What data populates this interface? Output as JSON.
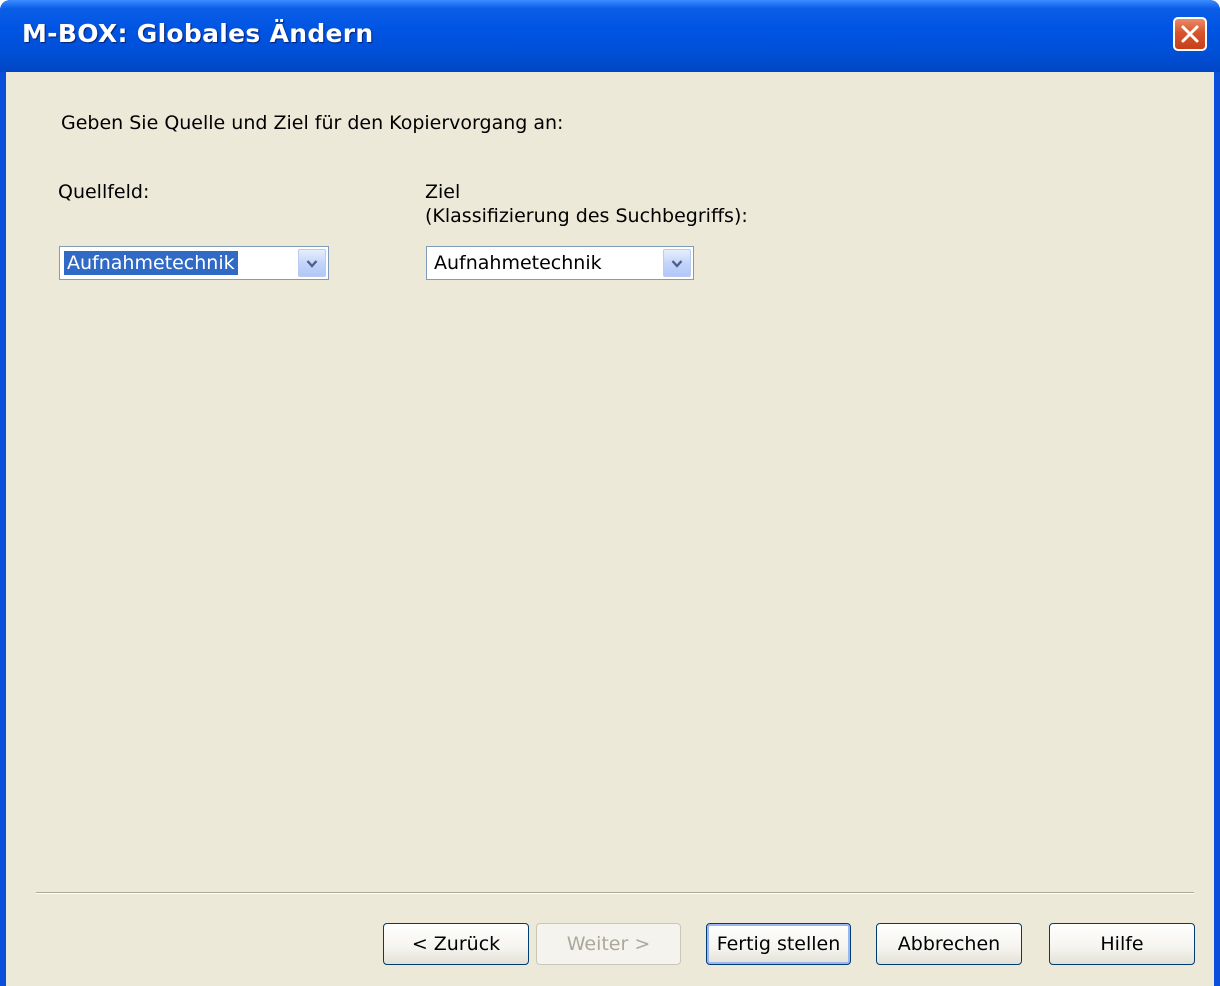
{
  "window": {
    "title": "M-BOX: Globales Ändern"
  },
  "icons": {
    "close": "close-icon",
    "dropdown": "chevron-down-icon"
  },
  "colors": {
    "titlebar": "#0054e3",
    "client_background": "#ece9d8",
    "selection": "#316ac5",
    "close_button": "#d9542c"
  },
  "dialog": {
    "instruction": "Geben Sie Quelle und Ziel für den Kopiervorgang an:",
    "source": {
      "label": "Quellfeld:",
      "value": "Aufnahmetechnik"
    },
    "target": {
      "label_line1": "Ziel",
      "label_line2": "(Klassifizierung des Suchbegriffs):",
      "value": "Aufnahmetechnik"
    }
  },
  "buttons": {
    "back": "< Zurück",
    "next": "Weiter >",
    "finish": "Fertig stellen",
    "cancel": "Abbrechen",
    "help": "Hilfe"
  }
}
